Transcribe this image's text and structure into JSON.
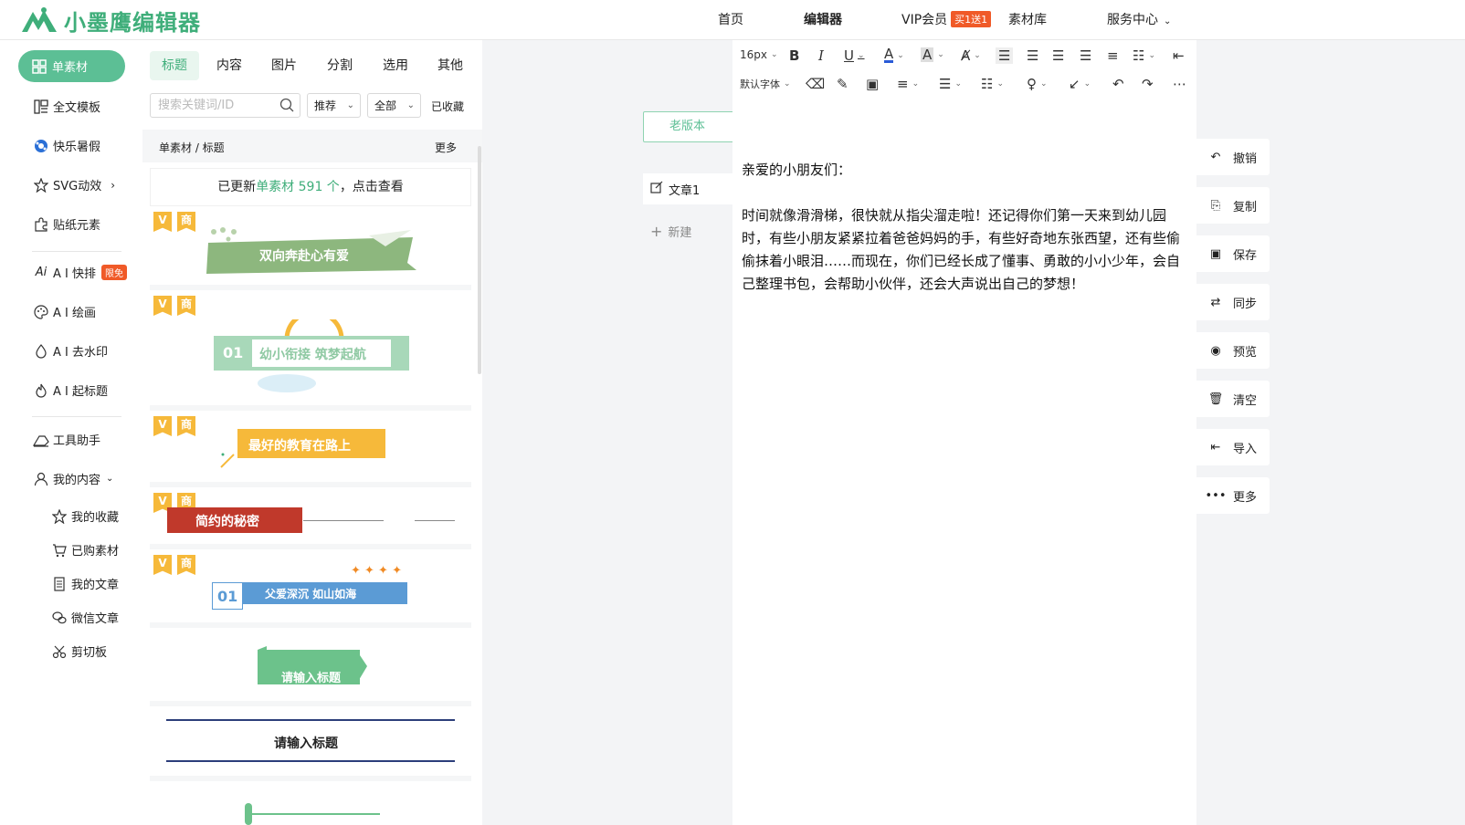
{
  "brand": {
    "name": "小墨鹰编辑器",
    "accent": "#5cbf95"
  },
  "topnav": {
    "home": "首页",
    "editor": "编辑器",
    "vip": "VIP会员",
    "vip_badge": "买1送1",
    "library": "素材库",
    "service": "服务中心"
  },
  "sidebar": {
    "active": "单素材",
    "items": [
      {
        "label": "全文模板",
        "icon": "template-icon"
      },
      {
        "label": "快乐暑假",
        "icon": "ball-icon"
      },
      {
        "label": "SVG动效",
        "icon": "star-icon"
      },
      {
        "label": "贴纸元素",
        "icon": "puzzle-icon"
      },
      {
        "label": "A I 快排",
        "icon": "ai-icon",
        "badge": "限免"
      },
      {
        "label": "A I 绘画",
        "icon": "palette-icon"
      },
      {
        "label": "A I 去水印",
        "icon": "drop-icon"
      },
      {
        "label": "A I 起标题",
        "icon": "fire-icon"
      },
      {
        "label": "工具助手",
        "icon": "eraser-icon"
      },
      {
        "label": "我的内容",
        "icon": "user-icon"
      }
    ],
    "sub_items": [
      {
        "label": "我的收藏",
        "icon": "star-outline-icon"
      },
      {
        "label": "已购素材",
        "icon": "cart-icon"
      },
      {
        "label": "我的文章",
        "icon": "article-icon"
      },
      {
        "label": "微信文章",
        "icon": "wechat-icon"
      },
      {
        "label": "剪切板",
        "icon": "scissors-icon"
      }
    ]
  },
  "panel": {
    "tabs": [
      "标题",
      "内容",
      "图片",
      "分割",
      "选用",
      "其他"
    ],
    "search_placeholder": "搜索关键词/ID",
    "filter_sort": "推荐",
    "filter_scope": "全部",
    "favorites": "已收藏",
    "breadcrumb": "单素材 / 标题",
    "more": "更多",
    "update_prefix": "已更新",
    "update_highlight": "单素材 591 个",
    "update_suffix": "，点击查看",
    "tag_v": "V",
    "tag_s": "商",
    "cards": [
      {
        "title": "双向奔赴心有爱"
      },
      {
        "num": "01",
        "title": "幼小衔接 筑梦起航"
      },
      {
        "title": "最好的教育在路上"
      },
      {
        "title": "简约的秘密"
      },
      {
        "num": "01",
        "title": "父爱深沉 如山如海"
      },
      {
        "title": "请输入标题"
      },
      {
        "title": "请输入标题"
      }
    ]
  },
  "docs": {
    "old_version": "老版本",
    "doc1": "文章1",
    "new_doc": "新建"
  },
  "toolbar": {
    "font_size": "16px",
    "font_family": "默认字体"
  },
  "editor": {
    "paragraphs": [
      "亲爱的小朋友们：",
      "时间就像滑滑梯，很快就从指尖溜走啦！还记得你们第一天来到幼儿园时，有些小朋友紧紧拉着爸爸妈妈的手，有些好奇地东张西望，还有些偷偷抹着小眼泪……而现在，你们已经长成了懂事、勇敢的小小少年，会自己整理书包，会帮助小伙伴，还会大声说出自己的梦想！"
    ]
  },
  "actions": [
    {
      "label": "撤销",
      "icon": "undo-icon"
    },
    {
      "label": "复制",
      "icon": "copy-icon"
    },
    {
      "label": "保存",
      "icon": "save-icon"
    },
    {
      "label": "同步",
      "icon": "sync-icon"
    },
    {
      "label": "预览",
      "icon": "eye-icon"
    },
    {
      "label": "清空",
      "icon": "trash-icon"
    },
    {
      "label": "导入",
      "icon": "import-icon"
    },
    {
      "label": "更多",
      "icon": "more-icon"
    }
  ]
}
